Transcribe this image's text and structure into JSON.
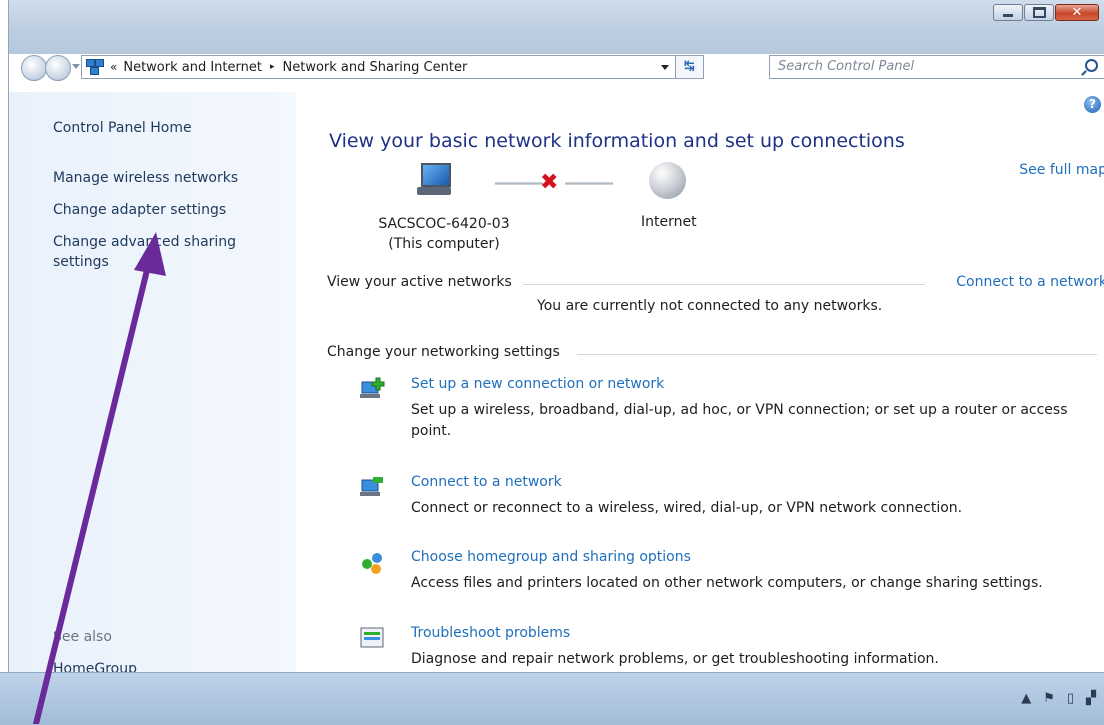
{
  "window": {
    "address": {
      "overflow": "«",
      "segments": [
        "Network and Internet",
        "Network and Sharing Center"
      ],
      "separator": "▸"
    },
    "search_placeholder": "Search Control Panel",
    "help": "?"
  },
  "sidebar": {
    "home": "Control Panel Home",
    "links": [
      "Manage wireless networks",
      "Change adapter settings",
      "Change advanced sharing",
      "settings"
    ],
    "see_also": "See also",
    "homegroup": "HomeGroup"
  },
  "main": {
    "heading": "View your basic network information and set up connections",
    "see_full_map": "See full map",
    "computer_name": "SACSCOC-6420-03",
    "computer_sub": "(This computer)",
    "internet": "Internet",
    "active_networks": "View your active networks",
    "connect_link": "Connect to a network",
    "not_connected": "You are currently not connected to any networks.",
    "change_settings": "Change your networking settings",
    "tasks": [
      {
        "title": "Set up a new connection or network",
        "desc": "Set up a wireless, broadband, dial-up, ad hoc, or VPN connection; or set up a router or access point.",
        "icon": "new-connection-icon"
      },
      {
        "title": "Connect to a network",
        "desc": "Connect or reconnect to a wireless, wired, dial-up, or VPN network connection.",
        "icon": "connect-network-icon"
      },
      {
        "title": "Choose homegroup and sharing options",
        "desc": "Access files and printers located on other network computers, or change sharing settings.",
        "icon": "homegroup-icon"
      },
      {
        "title": "Troubleshoot problems",
        "desc": "Diagnose and repair network problems, or get troubleshooting information.",
        "icon": "troubleshoot-icon"
      }
    ]
  },
  "colors": {
    "link": "#1f6fbd",
    "heading": "#1e3287",
    "annotation_arrow": "#6a2a9a",
    "error_x": "#d8121b"
  }
}
